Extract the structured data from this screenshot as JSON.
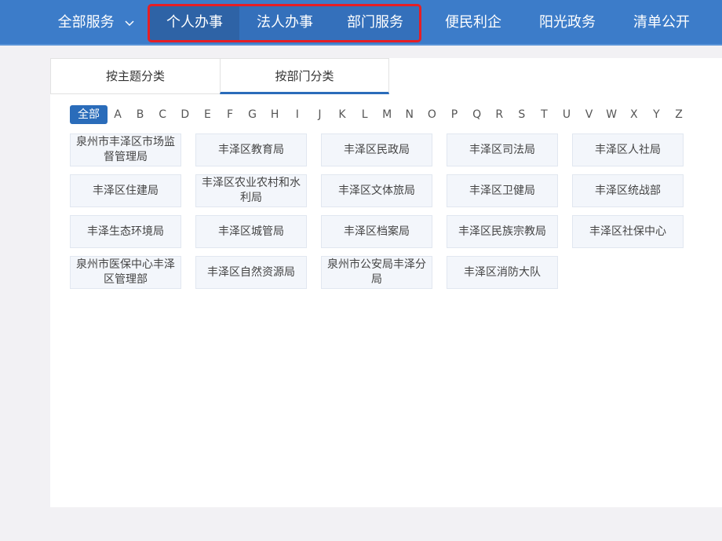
{
  "nav": {
    "all_services": "全部服务",
    "items": [
      "个人办事",
      "法人办事",
      "部门服务",
      "便民利企",
      "阳光政务",
      "清单公开"
    ]
  },
  "tabs": [
    "按主题分类",
    "按部门分类"
  ],
  "letters": {
    "all": "全部",
    "list": [
      "A",
      "B",
      "C",
      "D",
      "E",
      "F",
      "G",
      "H",
      "I",
      "J",
      "K",
      "L",
      "M",
      "N",
      "O",
      "P",
      "Q",
      "R",
      "S",
      "T",
      "U",
      "V",
      "W",
      "X",
      "Y",
      "Z"
    ]
  },
  "departments": [
    "泉州市丰泽区市场监督管理局",
    "丰泽区教育局",
    "丰泽区民政局",
    "丰泽区司法局",
    "丰泽区人社局",
    "丰泽区住建局",
    "丰泽区农业农村和水利局",
    "丰泽区文体旅局",
    "丰泽区卫健局",
    "丰泽区统战部",
    "丰泽生态环境局",
    "丰泽区城管局",
    "丰泽区档案局",
    "丰泽区民族宗教局",
    "丰泽区社保中心",
    "泉州市医保中心丰泽区管理部",
    "丰泽区自然资源局",
    "泉州市公安局丰泽分局",
    "丰泽区消防大队"
  ],
  "colors": {
    "nav_bg": "#3c7cc9",
    "accent": "#2a6cba",
    "highlight_border": "#e61e25"
  }
}
